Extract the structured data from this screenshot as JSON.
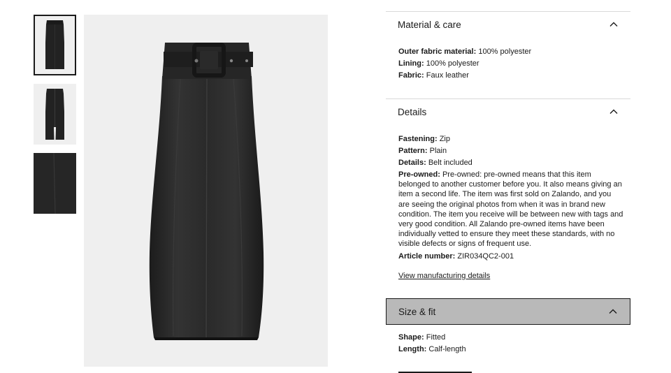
{
  "gallery": {
    "thumbnails": [
      {
        "name": "skirt-front",
        "active": true
      },
      {
        "name": "skirt-back",
        "active": false
      },
      {
        "name": "skirt-detail",
        "active": false
      }
    ],
    "main_image": "leather-pencil-skirt-front"
  },
  "material_care": {
    "title": "Material & care",
    "icon": "chevron-up-icon",
    "items": [
      {
        "label": "Outer fabric material:",
        "value": "100% polyester"
      },
      {
        "label": "Lining:",
        "value": "100% polyester"
      },
      {
        "label": "Fabric:",
        "value": "Faux leather"
      }
    ]
  },
  "details": {
    "title": "Details",
    "icon": "chevron-up-icon",
    "items": [
      {
        "label": "Fastening:",
        "value": "Zip"
      },
      {
        "label": "Pattern:",
        "value": "Plain"
      },
      {
        "label": "Details:",
        "value": "Belt included"
      }
    ],
    "pre_owned": {
      "label": "Pre-owned:",
      "value": "Pre-owned: pre-owned means that this item belonged to another customer before you. It also means giving an item a second life. The item was first sold on Zalando, and you are seeing the original photos from when it was in brand new condition. The item you receive will be between new with tags and very good condition. All Zalando pre-owned items have been individually vetted to ensure they meet these standards, with no visible defects or signs of frequent use."
    },
    "article": {
      "label": "Article number:",
      "value": "ZIR034QC2-001"
    },
    "link": "View manufacturing details"
  },
  "size_fit": {
    "title": "Size & fit",
    "icon": "chevron-up-icon",
    "highlight_color": "#b9b9b9",
    "items": [
      {
        "label": "Shape:",
        "value": "Fitted"
      },
      {
        "label": "Length:",
        "value": "Calf-length"
      }
    ]
  }
}
